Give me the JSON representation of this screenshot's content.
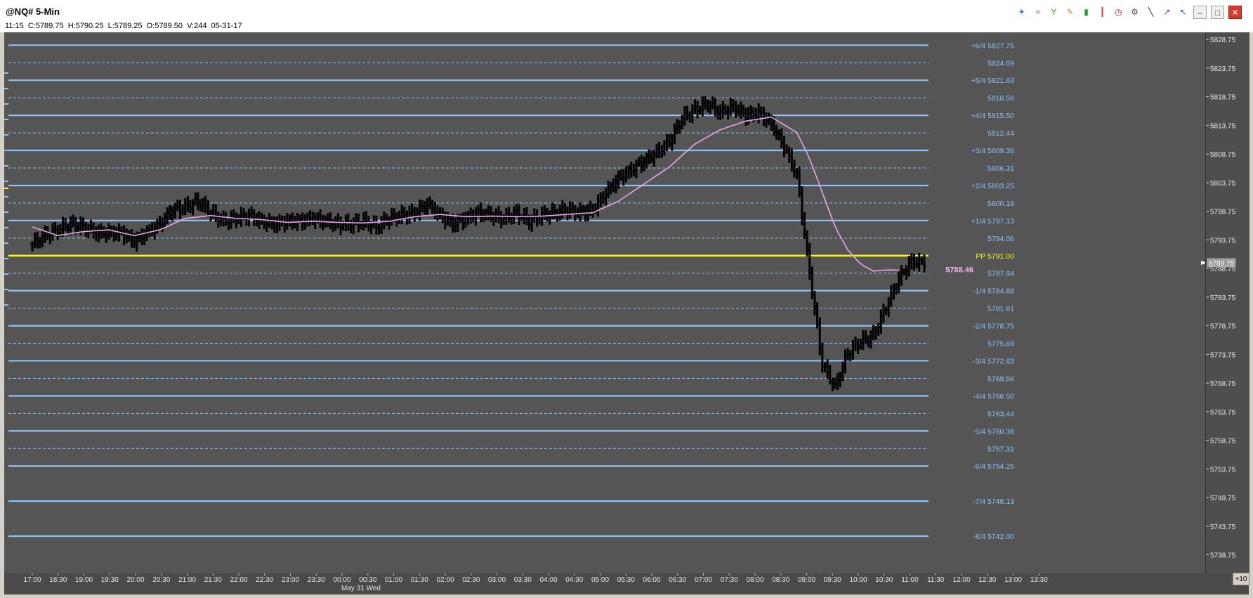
{
  "window": {
    "title": "@NQ# 5-Min",
    "info_line": "11:15  C:5789.75  H:5790.25  L:5789.25  O:5789.50  V:244  05-31-17"
  },
  "toolbar": {
    "icons": [
      "drawing-tools-icon",
      "waves-icon",
      "indicator-icon",
      "pencil-icon",
      "bar-chart-icon",
      "candlestick-icon",
      "clock-icon",
      "settings-icon",
      "line-tool-icon",
      "trend-tool-icon",
      "cursor-tool-icon",
      "minimize-icon",
      "maximize-icon",
      "close-icon"
    ]
  },
  "colors": {
    "background": "#555555",
    "level_line": "#8fc1f2",
    "pivot_line": "#ffff00",
    "moving_average": "#e6a6e6",
    "bars": "#000000",
    "level_label": "#8fc1f2",
    "pivot_label": "#ffff00",
    "ma_label": "#f0b0f0"
  },
  "corner_button": "+10",
  "chart_data": {
    "type": "ohlc-bar",
    "title": "@NQ# 5-Min",
    "ylim": [
      5735.5,
      5830.0
    ],
    "y_ticks": [
      "5828.75",
      "5823.75",
      "5818.75",
      "5813.75",
      "5808.75",
      "5803.75",
      "5798.75",
      "5793.75",
      "5788.75",
      "5783.75",
      "5778.75",
      "5773.75",
      "5768.75",
      "5763.75",
      "5758.75",
      "5753.75",
      "5748.75",
      "5743.75",
      "5738.75"
    ],
    "last_price_label": "5789.75",
    "ma_value_label": "5788.46",
    "x_ticks": [
      "17:00",
      "18:30",
      "19:00",
      "19:30",
      "20:00",
      "20:30",
      "21:00",
      "21:30",
      "22:00",
      "22:30",
      "23:00",
      "23:30",
      "00:00",
      "00:30",
      "01:00",
      "01:30",
      "02:00",
      "02:30",
      "03:00",
      "03:30",
      "04:00",
      "04:30",
      "05:00",
      "05:30",
      "06:00",
      "06:30",
      "07:00",
      "07:30",
      "08:00",
      "08:30",
      "09:00",
      "09:30",
      "10:00",
      "10:30",
      "11:00",
      "11:30",
      "12:00",
      "12:30",
      "13:00",
      "13:30"
    ],
    "date_label": "May 31 Wed",
    "levels": [
      {
        "label": "+6/4 5827.75",
        "value": 5827.75,
        "style": "solid"
      },
      {
        "label": "5824.69",
        "value": 5824.69,
        "style": "dashed"
      },
      {
        "label": "+5/4 5821.63",
        "value": 5821.63,
        "style": "solid"
      },
      {
        "label": "5818.56",
        "value": 5818.56,
        "style": "dashed"
      },
      {
        "label": "+4/4 5815.50",
        "value": 5815.5,
        "style": "solid"
      },
      {
        "label": "5812.44",
        "value": 5812.44,
        "style": "dashed"
      },
      {
        "label": "+3/4 5809.38",
        "value": 5809.38,
        "style": "solid"
      },
      {
        "label": "5806.31",
        "value": 5806.31,
        "style": "dashed"
      },
      {
        "label": "+2/4 5803.25",
        "value": 5803.25,
        "style": "solid"
      },
      {
        "label": "5800.19",
        "value": 5800.19,
        "style": "dashed"
      },
      {
        "label": "+1/4 5797.13",
        "value": 5797.13,
        "style": "solid"
      },
      {
        "label": "5794.06",
        "value": 5794.06,
        "style": "dashed"
      },
      {
        "label": "PP 5791.00",
        "value": 5791.0,
        "style": "pivot"
      },
      {
        "label": "5787.94",
        "value": 5787.94,
        "style": "dashed"
      },
      {
        "label": "-1/4 5784.88",
        "value": 5784.88,
        "style": "solid"
      },
      {
        "label": "5781.81",
        "value": 5781.81,
        "style": "dashed"
      },
      {
        "label": "-2/4 5778.75",
        "value": 5778.75,
        "style": "solid"
      },
      {
        "label": "5775.69",
        "value": 5775.69,
        "style": "dashed"
      },
      {
        "label": "-3/4 5772.63",
        "value": 5772.63,
        "style": "solid"
      },
      {
        "label": "5769.56",
        "value": 5769.56,
        "style": "dashed"
      },
      {
        "label": "-4/4 5766.50",
        "value": 5766.5,
        "style": "solid"
      },
      {
        "label": "5763.44",
        "value": 5763.44,
        "style": "dashed"
      },
      {
        "label": "-5/4 5760.38",
        "value": 5760.38,
        "style": "solid"
      },
      {
        "label": "5757.31",
        "value": 5757.31,
        "style": "dashed"
      },
      {
        "label": "-6/4 5754.25",
        "value": 5754.25,
        "style": "solid"
      },
      {
        "label": "-7/4 5748.13",
        "value": 5748.13,
        "style": "solid"
      },
      {
        "label": "-8/4 5742.00",
        "value": 5742.0,
        "style": "solid"
      }
    ],
    "price_path": [
      [
        0,
        5793.0
      ],
      [
        5,
        5794.5
      ],
      [
        10,
        5795.5
      ],
      [
        15,
        5796.5
      ],
      [
        20,
        5796.0
      ],
      [
        25,
        5795.0
      ],
      [
        30,
        5795.0
      ],
      [
        35,
        5795.0
      ],
      [
        40,
        5793.5
      ],
      [
        45,
        5795.0
      ],
      [
        50,
        5796.5
      ],
      [
        55,
        5799.0
      ],
      [
        60,
        5799.5
      ],
      [
        65,
        5800.5
      ],
      [
        70,
        5798.5
      ],
      [
        75,
        5797.0
      ],
      [
        80,
        5797.5
      ],
      [
        85,
        5798.0
      ],
      [
        90,
        5797.0
      ],
      [
        95,
        5796.5
      ],
      [
        100,
        5797.0
      ],
      [
        105,
        5797.0
      ],
      [
        110,
        5797.5
      ],
      [
        115,
        5797.0
      ],
      [
        120,
        5796.5
      ],
      [
        125,
        5796.5
      ],
      [
        130,
        5797.0
      ],
      [
        135,
        5796.0
      ],
      [
        140,
        5797.5
      ],
      [
        145,
        5798.0
      ],
      [
        150,
        5798.5
      ],
      [
        155,
        5800.0
      ],
      [
        160,
        5798.0
      ],
      [
        165,
        5796.5
      ],
      [
        170,
        5797.5
      ],
      [
        175,
        5798.5
      ],
      [
        180,
        5798.0
      ],
      [
        185,
        5797.5
      ],
      [
        190,
        5798.5
      ],
      [
        195,
        5797.0
      ],
      [
        200,
        5798.0
      ],
      [
        205,
        5798.5
      ],
      [
        210,
        5799.0
      ],
      [
        215,
        5798.5
      ],
      [
        220,
        5799.0
      ],
      [
        225,
        5802.0
      ],
      [
        230,
        5804.5
      ],
      [
        235,
        5806.0
      ],
      [
        240,
        5807.5
      ],
      [
        245,
        5809.0
      ],
      [
        250,
        5811.0
      ],
      [
        255,
        5815.0
      ],
      [
        260,
        5816.5
      ],
      [
        265,
        5817.5
      ],
      [
        270,
        5816.0
      ],
      [
        275,
        5817.0
      ],
      [
        280,
        5815.5
      ],
      [
        285,
        5816.0
      ],
      [
        290,
        5814.0
      ],
      [
        295,
        5810.0
      ],
      [
        300,
        5805.0
      ],
      [
        305,
        5788.0
      ],
      [
        310,
        5772.0
      ],
      [
        315,
        5768.0
      ],
      [
        320,
        5774.0
      ],
      [
        325,
        5776.0
      ],
      [
        330,
        5777.0
      ],
      [
        335,
        5782.0
      ],
      [
        340,
        5787.0
      ],
      [
        345,
        5790.0
      ],
      [
        350,
        5789.75
      ]
    ],
    "ma_path": [
      [
        0,
        5796.0
      ],
      [
        10,
        5794.5
      ],
      [
        20,
        5795.2
      ],
      [
        30,
        5795.5
      ],
      [
        40,
        5794.5
      ],
      [
        50,
        5795.5
      ],
      [
        60,
        5797.5
      ],
      [
        70,
        5798.0
      ],
      [
        80,
        5797.5
      ],
      [
        90,
        5797.3
      ],
      [
        100,
        5796.8
      ],
      [
        110,
        5797.0
      ],
      [
        120,
        5796.8
      ],
      [
        130,
        5796.7
      ],
      [
        140,
        5797.0
      ],
      [
        150,
        5797.8
      ],
      [
        160,
        5798.2
      ],
      [
        170,
        5797.8
      ],
      [
        180,
        5797.9
      ],
      [
        190,
        5797.8
      ],
      [
        200,
        5797.9
      ],
      [
        210,
        5798.2
      ],
      [
        220,
        5798.5
      ],
      [
        230,
        5800.5
      ],
      [
        240,
        5803.5
      ],
      [
        250,
        5806.5
      ],
      [
        260,
        5810.5
      ],
      [
        270,
        5813.0
      ],
      [
        280,
        5814.5
      ],
      [
        290,
        5815.2
      ],
      [
        300,
        5812.5
      ],
      [
        305,
        5808.0
      ],
      [
        310,
        5802.0
      ],
      [
        315,
        5796.0
      ],
      [
        320,
        5792.0
      ],
      [
        325,
        5789.5
      ],
      [
        330,
        5788.3
      ],
      [
        335,
        5788.5
      ],
      [
        340,
        5788.46
      ]
    ]
  }
}
